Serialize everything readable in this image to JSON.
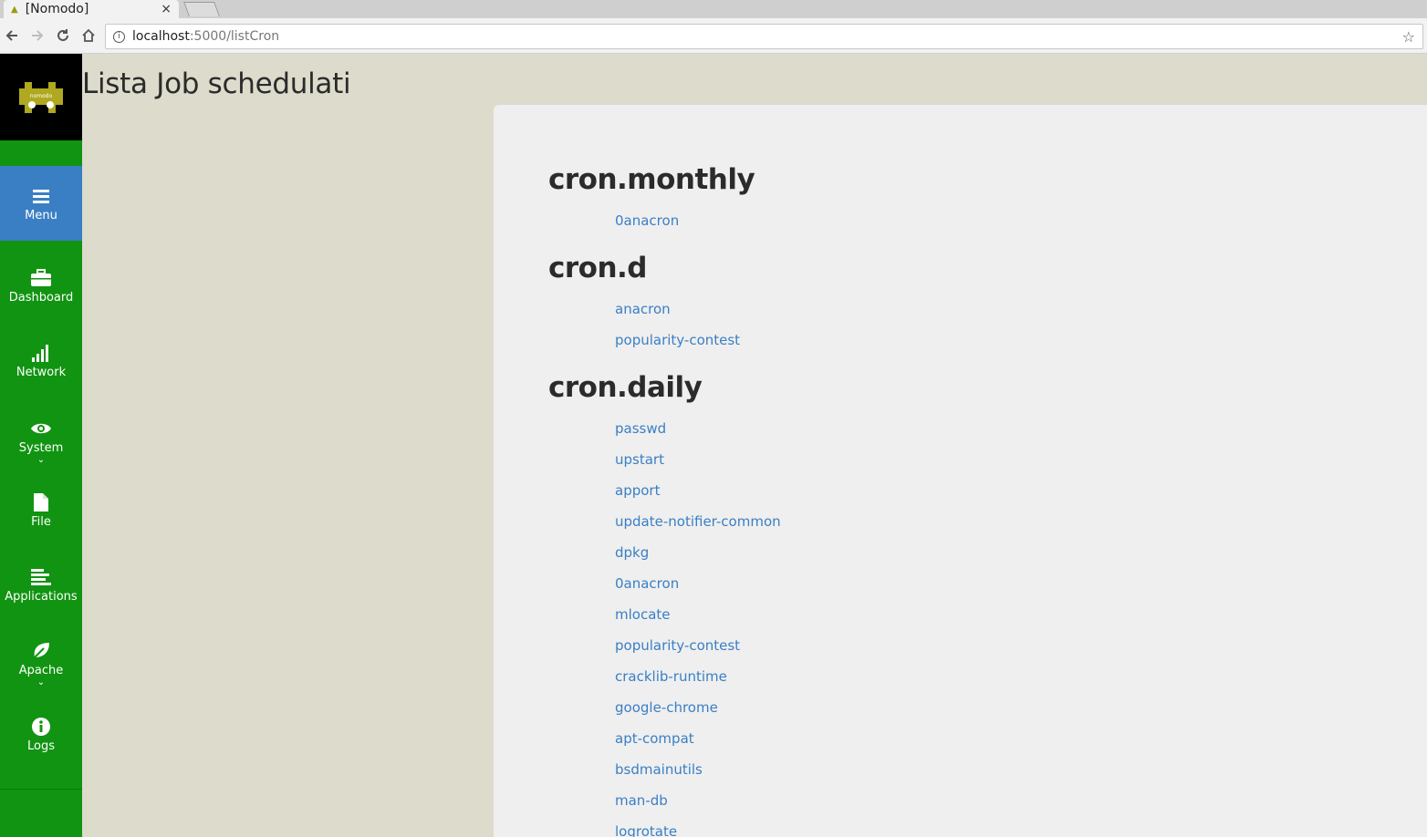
{
  "browser": {
    "tab_title": "[Nomodo]",
    "tab_close": "×",
    "url_host": "localhost",
    "url_path": ":5000/listCron"
  },
  "sidebar": {
    "logo_text": "nomodo",
    "items": [
      {
        "label": "Menu",
        "icon": "hamburger-icon",
        "active": true
      },
      {
        "label": "Dashboard",
        "icon": "briefcase-icon"
      },
      {
        "label": "Network",
        "icon": "signal-bars-icon"
      },
      {
        "label": "System",
        "icon": "eye-icon",
        "has_submenu": true
      },
      {
        "label": "File",
        "icon": "file-icon"
      },
      {
        "label": "Applications",
        "icon": "align-left-icon"
      },
      {
        "label": "Apache",
        "icon": "leaf-icon",
        "has_submenu": true
      },
      {
        "label": "Logs",
        "icon": "info-circle-icon"
      }
    ],
    "colors": {
      "background": "#119411",
      "active": "#3a7fc4"
    }
  },
  "main": {
    "title": "Lista Job schedulati",
    "sections": [
      {
        "name": "cron.monthly",
        "jobs": [
          "0anacron"
        ]
      },
      {
        "name": "cron.d",
        "jobs": [
          "anacron",
          "popularity-contest"
        ]
      },
      {
        "name": "cron.daily",
        "jobs": [
          "passwd",
          "upstart",
          "apport",
          "update-notifier-common",
          "dpkg",
          "0anacron",
          "mlocate",
          "popularity-contest",
          "cracklib-runtime",
          "google-chrome",
          "apt-compat",
          "bsdmainutils",
          "man-db",
          "logrotate"
        ]
      }
    ]
  }
}
